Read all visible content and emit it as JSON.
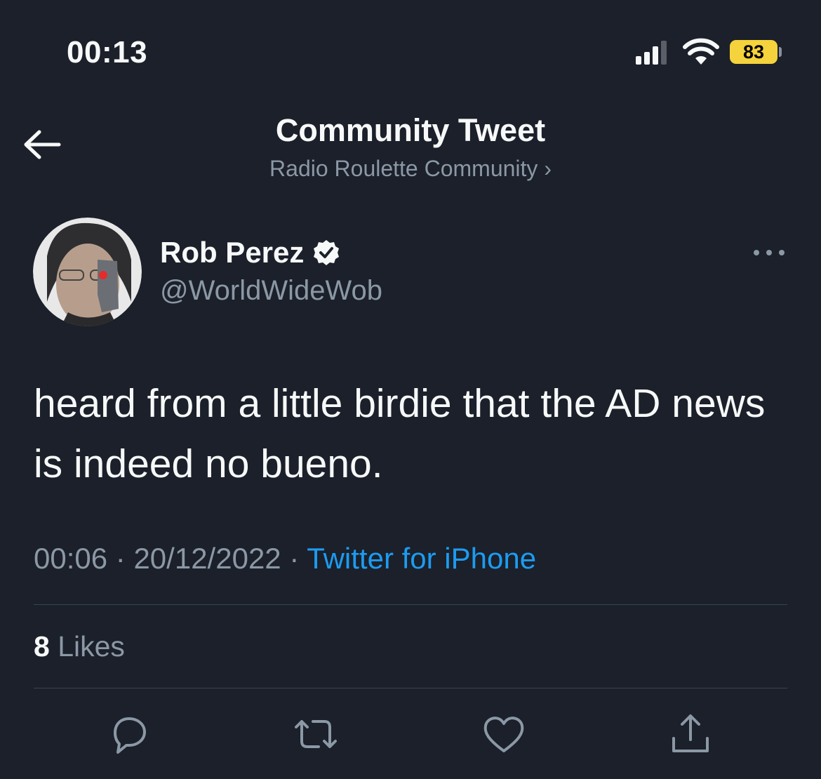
{
  "status_bar": {
    "time": "00:13",
    "battery": "83"
  },
  "nav": {
    "title": "Community Tweet",
    "community": "Radio Roulette Community ›"
  },
  "author": {
    "name": "Rob Perez",
    "handle": "@WorldWideWob"
  },
  "tweet": {
    "text": "heard from a little birdie that the AD news is indeed no bueno.",
    "time": "00:06",
    "separator": "·",
    "date": "20/12/2022",
    "source": "Twitter for iPhone"
  },
  "stats": {
    "likes_count": "8",
    "likes_label": "Likes"
  },
  "icons": {
    "back": "arrow-left-icon",
    "more": "more-horizontal-icon",
    "reply": "reply-icon",
    "retweet": "retweet-icon",
    "like": "heart-icon",
    "share": "share-icon"
  },
  "colors": {
    "background": "#1b202a",
    "accent": "#1d9bf0",
    "battery": "#f5d33c",
    "secondary_text": "#8b98a5"
  }
}
